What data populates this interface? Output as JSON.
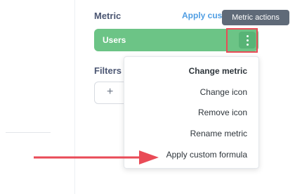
{
  "editor": {
    "metric_label": "Metric",
    "apply_link": "Apply custom",
    "tooltip": "Metric actions",
    "metric_value": "Users",
    "filters_label": "Filters",
    "add_filter": "+"
  },
  "menu": {
    "items": [
      {
        "label": "Change metric"
      },
      {
        "label": "Change icon"
      },
      {
        "label": "Remove icon"
      },
      {
        "label": "Rename metric"
      },
      {
        "label": "Apply custom formula"
      }
    ]
  },
  "colors": {
    "metric_pill": "#6cc486",
    "highlight": "#e94b57",
    "accent_link": "#509ee3",
    "tooltip": "#5f6a78"
  }
}
